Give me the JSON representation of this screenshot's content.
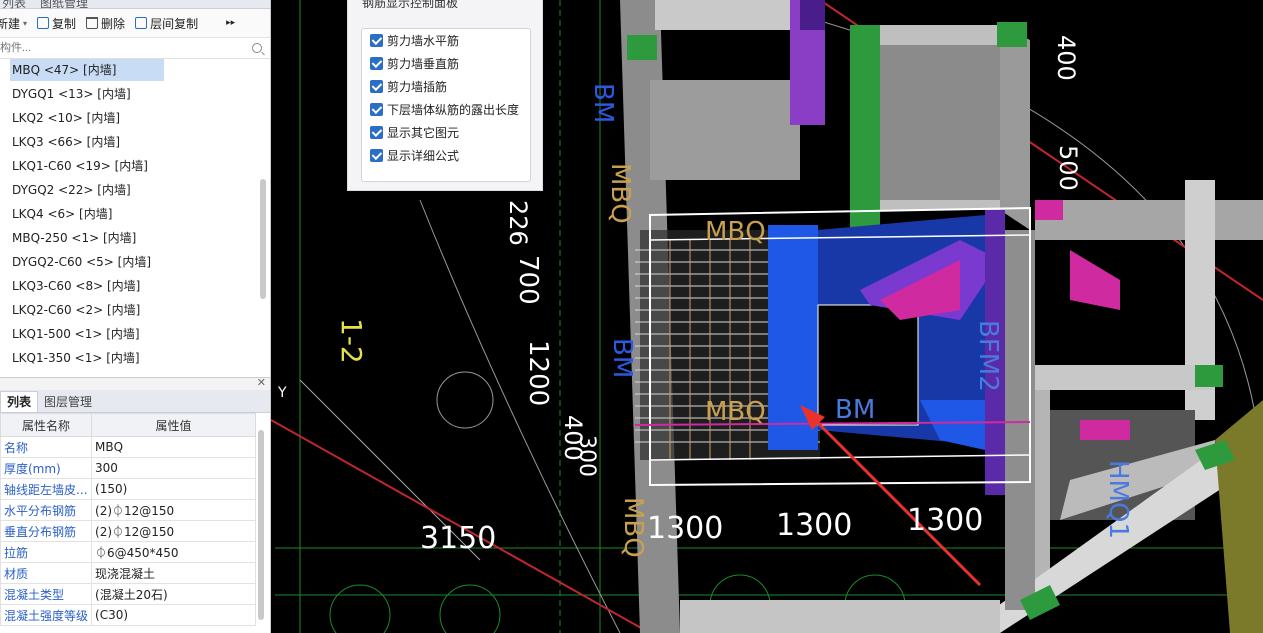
{
  "left_top_tabs": [
    "列表",
    "图纸管理"
  ],
  "toolbar": {
    "new_label": "新建",
    "copy_label": "复制",
    "delete_label": "删除",
    "floor_copy_label": "层间复制"
  },
  "search": {
    "placeholder": "构件..."
  },
  "components": [
    {
      "label": "MBQ <47> [内墙]",
      "selected": true
    },
    {
      "label": "DYGQ1 <13> [内墙]"
    },
    {
      "label": "LKQ2 <10> [内墙]"
    },
    {
      "label": "LKQ3 <66> [内墙]"
    },
    {
      "label": "LKQ1-C60 <19> [内墙]"
    },
    {
      "label": "DYGQ2 <22> [内墙]"
    },
    {
      "label": "LKQ4 <6> [内墙]"
    },
    {
      "label": "MBQ-250 <1> [内墙]"
    },
    {
      "label": "DYGQ2-C60 <5> [内墙]"
    },
    {
      "label": "LKQ3-C60 <8> [内墙]"
    },
    {
      "label": "LKQ2-C60 <2> [内墙]"
    },
    {
      "label": "LKQ1-500 <1> [内墙]"
    },
    {
      "label": "LKQ1-350 <1> [内墙]"
    }
  ],
  "bottom_tabs": [
    "列表",
    "图层管理"
  ],
  "props_header": {
    "name": "属性名称",
    "value": "属性值"
  },
  "properties": [
    {
      "name": "名称",
      "value": "MBQ"
    },
    {
      "name": "厚度(mm)",
      "value": "300"
    },
    {
      "name": "轴线距左墙皮...",
      "value": "(150)"
    },
    {
      "name": "水平分布钢筋",
      "value": "(2)⏀12@150"
    },
    {
      "name": "垂直分布钢筋",
      "value": "(2)⏀12@150"
    },
    {
      "name": "拉筋",
      "value": "⏀6@450*450"
    },
    {
      "name": "材质",
      "value": "现浇混凝土"
    },
    {
      "name": "混凝土类型",
      "value": "(混凝土20石)"
    },
    {
      "name": "混凝土强度等级",
      "value": "(C30)"
    }
  ],
  "overlay": {
    "title": "钢筋显示控制面板",
    "options": [
      {
        "label": "剪力墙水平筋",
        "checked": true
      },
      {
        "label": "剪力墙垂直筋",
        "checked": true
      },
      {
        "label": "剪力墙插筋",
        "checked": true
      },
      {
        "label": "下层墙体纵筋的露出长度",
        "checked": true
      },
      {
        "label": "显示其它图元",
        "checked": true
      },
      {
        "label": "显示详细公式",
        "checked": true
      }
    ]
  },
  "canvas_labels": {
    "dims": [
      "3150",
      "1300",
      "1300",
      "1300",
      "700",
      "1200",
      "400",
      "300",
      "500",
      "400",
      "226"
    ],
    "tags": [
      "BM",
      "MBQ",
      "BM",
      "MBQ",
      "BFM2",
      "BM",
      "MBQ",
      "MBQ",
      "HMQ1",
      "1-2",
      "Y"
    ]
  },
  "colors": {
    "accent": "#2a6ec6",
    "canvas": "#000000",
    "arrow": "#e8322a"
  }
}
